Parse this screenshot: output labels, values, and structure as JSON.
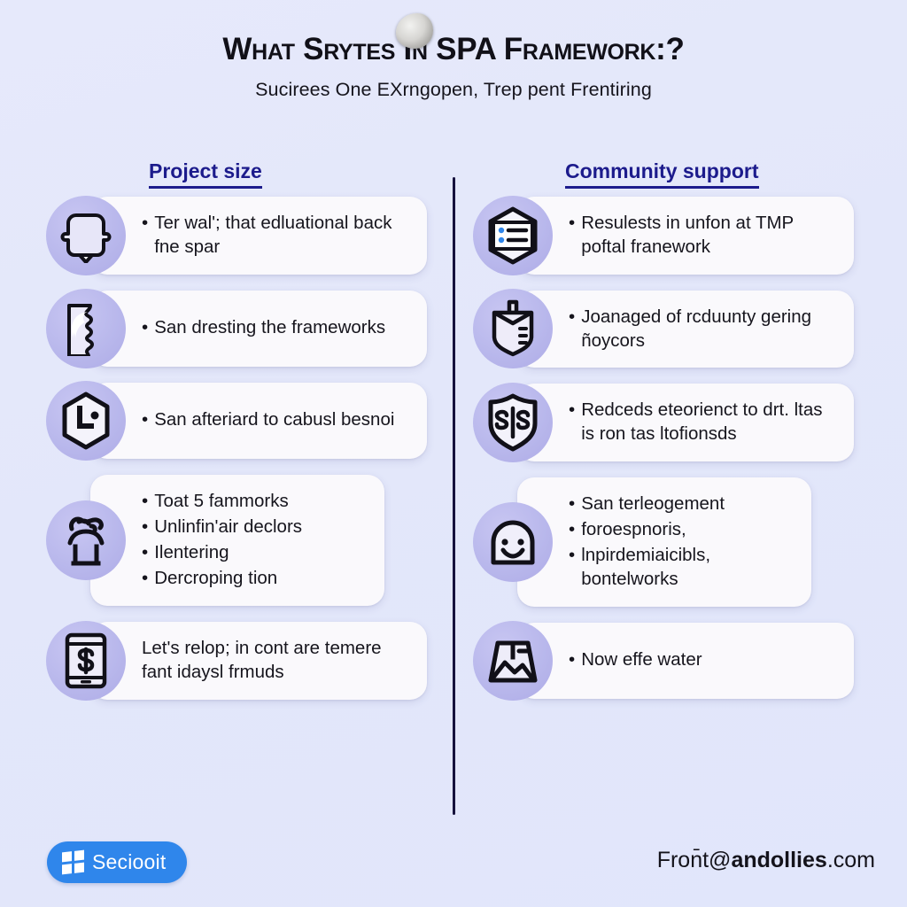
{
  "header": {
    "title": "What Srytes  in SPA Framework:?",
    "subtitle": "Sucirees One EXrngopen, Trep pent Frentiring"
  },
  "columns": [
    {
      "heading": "Project size",
      "side": "left",
      "items": [
        {
          "icon": "person-head-icon",
          "bullets": [
            "Ter wal'; that edluational back fne spar"
          ],
          "narrow": false
        },
        {
          "icon": "face-profile-icon",
          "bullets": [
            "San dresting the frameworks"
          ],
          "narrow": false
        },
        {
          "icon": "hexagon-location-icon",
          "bullets": [
            "San afteriard to cabusl besnoi"
          ],
          "narrow": false
        },
        {
          "icon": "abstract-figure-icon",
          "bullets": [
            "Toat 5 fammorks",
            "Unlinfin'air declors",
            "Ilentering",
            "Dercroping tion"
          ],
          "narrow": true
        },
        {
          "icon": "phone-dollar-icon",
          "bullets": [],
          "text": "Let's relop; in cont are temere fant idaysl frmuds",
          "narrow": false
        }
      ]
    },
    {
      "heading": "Community support",
      "side": "right",
      "items": [
        {
          "icon": "hexagon-list-icon",
          "bullets": [
            "Resulests in unfon at TMP poftal franework"
          ],
          "narrow": false
        },
        {
          "icon": "shield-badge-icon",
          "bullets": [
            "Joanaged of rcduunty gering ñoycors"
          ],
          "narrow": false
        },
        {
          "icon": "shield-ss-icon",
          "bullets": [
            "Redceds eteorienct to drt. ltas is ron tas ltofionsds"
          ],
          "narrow": false
        },
        {
          "icon": "smiley-face-icon",
          "bullets": [
            "San terleogement",
            "foroespnoris,",
            "lnpirdemiaicibls, bontelworks"
          ],
          "narrow": true
        },
        {
          "icon": "image-placeholder-icon",
          "bullets": [
            "Now effe water"
          ],
          "narrow": false
        }
      ]
    }
  ],
  "footer": {
    "brand_label": "Seciooit",
    "brand_icon": "windows-logo-icon",
    "email_prefix": "Fron̄t@",
    "email_domain": "andollies",
    "email_tld": ".com"
  },
  "colors": {
    "background": "#e4e7fa",
    "card": "#faf9fc",
    "icon_circle": "#b9b8ec",
    "heading": "#1c1b8c",
    "divider": "#16123d",
    "brand_blue": "#2f86eb",
    "text": "#16151d"
  }
}
